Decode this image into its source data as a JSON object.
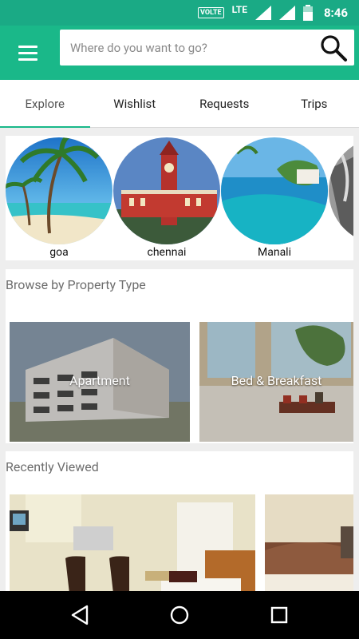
{
  "status": {
    "volte": "VOLTE",
    "lte": "LTE",
    "time": "8:46"
  },
  "search": {
    "placeholder": "Where do you want to go?"
  },
  "tabs": [
    "Explore",
    "Wishlist",
    "Requests",
    "Trips"
  ],
  "cities": [
    "goa",
    "chennai",
    "Manali"
  ],
  "property_section": {
    "title": "Browse by Property Type",
    "types": [
      "Apartment",
      "Bed & Breakfast"
    ]
  },
  "recent_section": {
    "title": "Recently Viewed"
  },
  "colors": {
    "brand_green": "#1ab889",
    "status_green": "#1aaa85"
  }
}
